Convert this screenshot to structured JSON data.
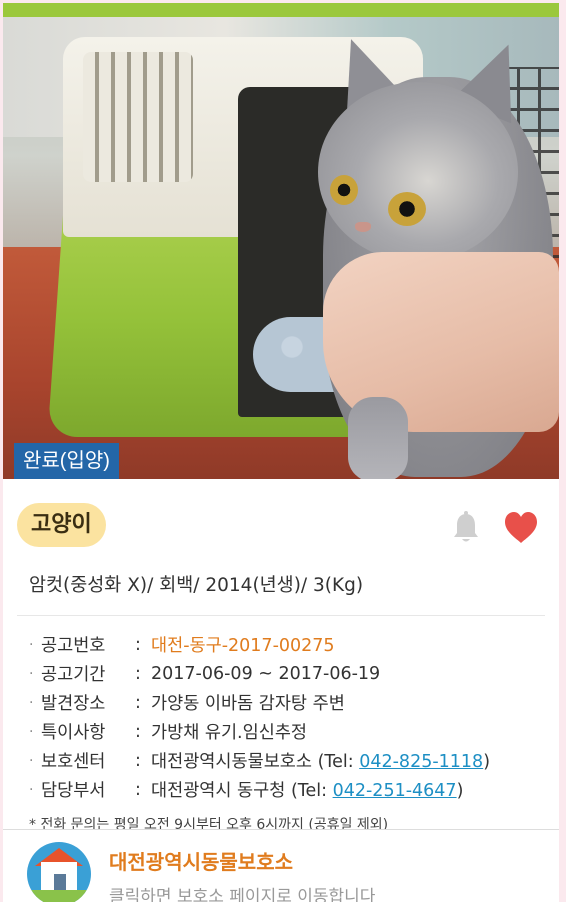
{
  "photo": {
    "status_badge": "완료(입양)"
  },
  "animal": {
    "type": "고양이",
    "summary": "암컷(중성화 X)/ 회백/ 2014(년생)/ 3(Kg)",
    "icons": [
      "bell-icon",
      "heart-icon"
    ],
    "heart_color": "#e8504a"
  },
  "details": [
    {
      "label": "공고번호",
      "value": "대전-동구-2017-00275"
    },
    {
      "label": "공고기간",
      "value": "2017-06-09 ~ 2017-06-19"
    },
    {
      "label": "발견장소",
      "value": "가양동 이바돔 감자탕 주변"
    },
    {
      "label": "특이사항",
      "value": "가방채 유기.임신추정"
    },
    {
      "label": "보호센터",
      "value": "대전광역시동물보호소",
      "tel_prefix": "(Tel: ",
      "tel": "042-825-1118",
      "tel_suffix": ")"
    },
    {
      "label": "담당부서",
      "value": "대전광역시 동구청",
      "tel_prefix": "(Tel: ",
      "tel": "042-251-4647",
      "tel_suffix": ")"
    }
  ],
  "note": "* 전화 문의는 평일 오전 9시부터 오후 6시까지 (공휴일 제외)",
  "shelter": {
    "name": "대전광역시동물보호소",
    "subtitle": "클릭하면 보호소 페이지로 이동합니다"
  },
  "colors": {
    "top_bar": "#9bc83c",
    "badge": "#2366a8",
    "pill": "#fbe3a0",
    "accent_orange": "#e07c1e",
    "link": "#1d8fc4"
  }
}
